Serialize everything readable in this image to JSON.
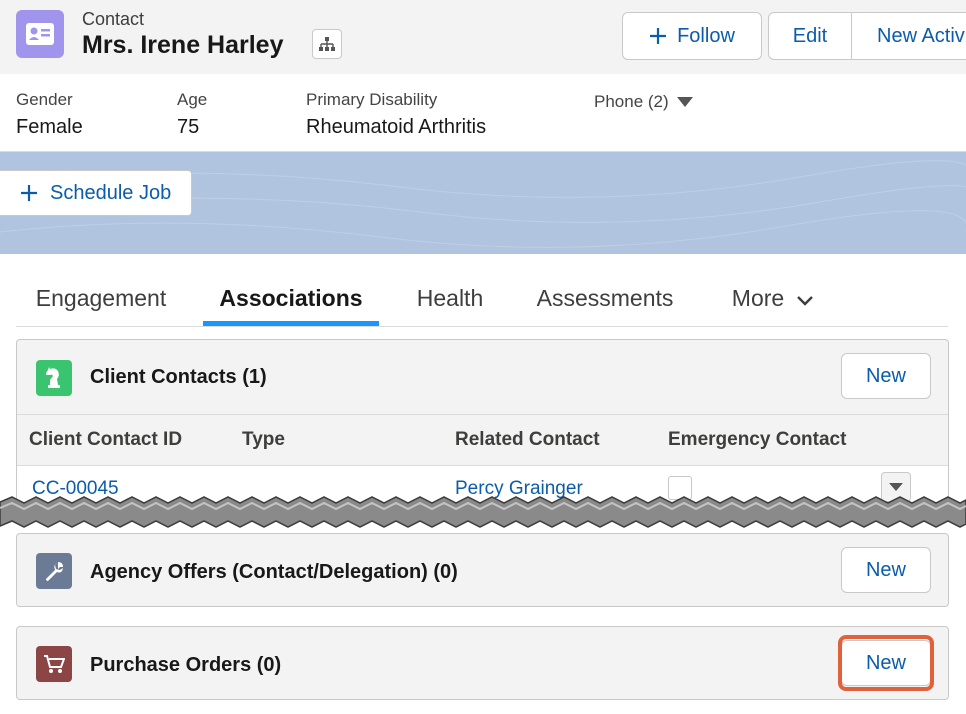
{
  "header": {
    "object_label": "Contact",
    "record_name": "Mrs. Irene Harley",
    "actions": {
      "follow": "Follow",
      "edit": "Edit",
      "new_activity": "New Activi"
    }
  },
  "highlights": {
    "gender_label": "Gender",
    "gender_value": "Female",
    "age_label": "Age",
    "age_value": "75",
    "disability_label": "Primary Disability",
    "disability_value": "Rheumatoid Arthritis",
    "phone_label": "Phone (2)"
  },
  "schedule_job_label": "Schedule Job",
  "tabs": {
    "engagement": "Engagement",
    "associations": "Associations",
    "health": "Health",
    "assessments": "Assessments",
    "more": "More"
  },
  "client_contacts": {
    "title": "Client Contacts (1)",
    "new_label": "New",
    "columns": {
      "id": "Client Contact ID",
      "type": "Type",
      "related": "Related Contact",
      "emergency": "Emergency Contact"
    },
    "rows": [
      {
        "id": "CC-00045",
        "type": "",
        "related": "Percy Grainger"
      }
    ]
  },
  "agency_offers": {
    "title": "Agency Offers (Contact/Delegation) (0)",
    "new_label": "New"
  },
  "purchase_orders": {
    "title": "Purchase Orders (0)",
    "new_label": "New"
  },
  "colors": {
    "contact_icon": "#a094ed",
    "client_contacts_icon": "#3bc470",
    "agency_offers_icon": "#6b7a95",
    "purchase_orders_icon": "#8c4545",
    "brand_blue": "#0b5cab",
    "tab_active": "#1b96ff",
    "highlight": "#e0623c"
  },
  "icons": {
    "contact": "contact-card-icon",
    "hierarchy": "hierarchy-icon",
    "follow": "plus-icon",
    "schedule": "plus-icon",
    "client_contacts": "chess-knight-icon",
    "agency_offers": "wrench-icon",
    "purchase_orders": "shopping-cart-icon"
  }
}
